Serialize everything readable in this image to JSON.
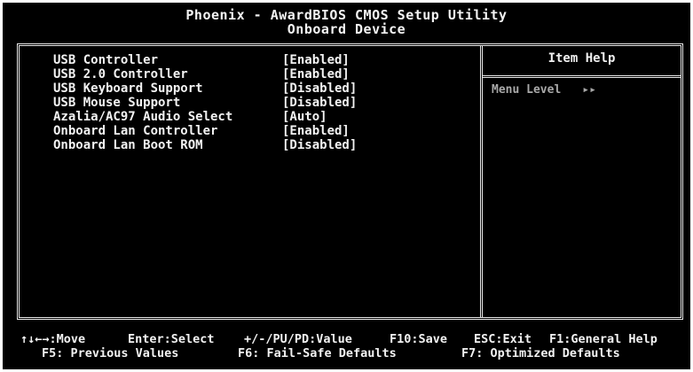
{
  "header": {
    "title": "Phoenix - AwardBIOS CMOS Setup Utility",
    "subtitle": "Onboard Device"
  },
  "settings": [
    {
      "label": "USB Controller",
      "value": "[Enabled]"
    },
    {
      "label": "USB 2.0 Controller",
      "value": "[Enabled]"
    },
    {
      "label": "USB Keyboard Support",
      "value": "[Disabled]"
    },
    {
      "label": "USB Mouse Support",
      "value": "[Disabled]"
    },
    {
      "label": "Azalia/AC97 Audio Select",
      "value": "[Auto]"
    },
    {
      "label": "Onboard Lan Controller",
      "value": "[Enabled]"
    },
    {
      "label": "Onboard Lan Boot ROM",
      "value": "[Disabled]"
    }
  ],
  "help": {
    "title": "Item Help",
    "menu_level_label": "Menu Level",
    "menu_level_arrows": "▸▸"
  },
  "footer": {
    "line1": {
      "move": "↑↓←→:Move",
      "select": "Enter:Select",
      "value": "+/-/PU/PD:Value",
      "save": "F10:Save",
      "exit": "ESC:Exit",
      "help": "F1:General Help"
    },
    "line2": {
      "previous": "F5: Previous Values",
      "failsafe": "F6: Fail-Safe Defaults",
      "optimized": "F7: Optimized Defaults"
    }
  },
  "colors": {
    "background": "#000000",
    "text": "#f2f2f2",
    "help_text": "#a9a9a9"
  }
}
